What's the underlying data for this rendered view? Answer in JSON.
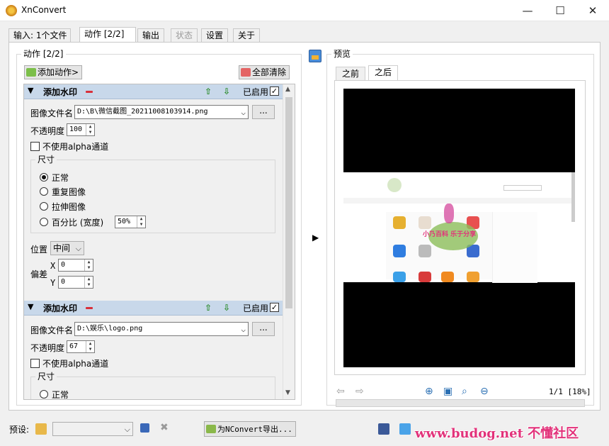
{
  "window": {
    "title": "XnConvert",
    "minimize": "—",
    "maximize": "☐",
    "close": "✕"
  },
  "tabs": [
    {
      "label": "输入: 1个文件"
    },
    {
      "label": "动作 [2/2]"
    },
    {
      "label": "输出"
    },
    {
      "label": "状态"
    },
    {
      "label": "设置"
    },
    {
      "label": "关于"
    }
  ],
  "actions_panel": {
    "title": "动作 [2/2]",
    "add_action_label": "添加动作>",
    "clear_all_label": "全部清除",
    "actions": [
      {
        "name": "添加水印",
        "enabled_label": "已启用",
        "enabled": true,
        "file_label": "图像文件名",
        "file_value": "D:\\B\\微信截图_20211008103914.png",
        "browse_label": "...",
        "opacity_label": "不透明度",
        "opacity_value": "100",
        "no_alpha_label": "不使用alpha通道",
        "size_group_title": "尺寸",
        "size_options": [
          "正常",
          "重复图像",
          "拉伸图像",
          "百分比 (宽度)"
        ],
        "size_selected": "正常",
        "percent_value": "50%",
        "position_label": "位置",
        "position_value": "中间",
        "offset_label": "偏差",
        "x_label": "X",
        "x_value": "0",
        "y_label": "Y",
        "y_value": "0"
      },
      {
        "name": "添加水印",
        "enabled_label": "已启用",
        "enabled": true,
        "file_label": "图像文件名",
        "file_value": "D:\\娱乐\\logo.png",
        "browse_label": "...",
        "opacity_label": "不透明度",
        "opacity_value": "67",
        "no_alpha_label": "不使用alpha通道",
        "size_group_title": "尺寸",
        "first_option": "正常"
      }
    ]
  },
  "preview": {
    "title": "预览",
    "tab_before": "之前",
    "tab_after": "之后",
    "zoom_label": "1/1 [18%]",
    "site_banner_text": "小乃百科 乐于分享"
  },
  "bottom": {
    "preset_label": "预设:",
    "export_label": "为NConvert导出...",
    "watermark": "www.budog.net 不懂社区"
  },
  "colors": {
    "action_header": "#c8d8ea",
    "watermark": "#e2327a",
    "accent_blue": "#2a6fb3"
  },
  "icons": [
    "app-icon",
    "add-icon",
    "clear-icon",
    "minus-icon",
    "move-up-icon",
    "move-down-icon",
    "preview-icon",
    "arrow-left-icon",
    "arrow-right-icon",
    "zoom-in-icon",
    "fit-icon",
    "zoom-actual-icon",
    "zoom-out-icon",
    "folder-icon",
    "save-icon",
    "delete-icon",
    "facebook-icon",
    "twitter-icon"
  ]
}
